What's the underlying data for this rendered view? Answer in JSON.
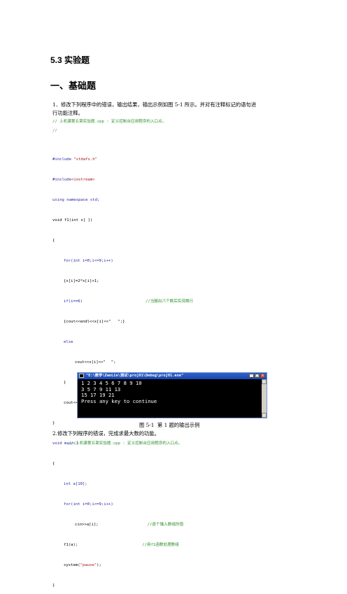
{
  "section_title": "5.3 实验题",
  "part_title": "一、基础题",
  "q1": {
    "line1": "1．修改下列程序中的错误，输出结果，输出示例如图 5-1 所示。并对有注释标记的语句进",
    "line2": "行功能注释。"
  },
  "code": {
    "c1": "// 上机课第五章实验题.cpp : 定义控制台应用程序的入口点。",
    "c2": "//",
    "lines": {
      "l1a": "#include ",
      "l1b": "\"stdafx.h\"",
      "l2a": "#include",
      "l2b": "<iostream>",
      "l3": "using namespace std;",
      "l4": "void f1(int x[ ])",
      "l5": "{",
      "l6": "for(int i=0;i<=9;i++)",
      "l7": "{x[i]=2*x[i]+1;",
      "l8a": "if(i==6)",
      "l8b": "//当输出六个数后实现换行",
      "l9a": "{cout<<endl<<x[i]<<\"",
      "l9b": "\";}",
      "l10": "else",
      "l11a": "cout<<x[i]<<\"",
      "l11b": "\";",
      "l12": "}",
      "l13": "cout<<endl;",
      "l14": "}",
      "l15": "void main()",
      "l16": "{",
      "l17": "int a[10];",
      "l18": "for(int i=0;i<=9;i++)",
      "l19a": "cin>>a[i];",
      "l19b": "//逐个输入数组的值",
      "l20a": "f1(a);",
      "l20b": "//用f1函数处理数组",
      "l21a": "system(",
      "l21b": "\"pause\"",
      "l21c": ");",
      "l22": "}"
    }
  },
  "console": {
    "title": "\"E:\\教学\\ZaoLin\\测试\\proj01\\Debug\\proj01.exe\"",
    "line1": "1 2 3 4 5 6 7 8 9 10",
    "line2": "3  5  7  9  11  13",
    "line3": "15  17  19  21",
    "line4": "Press any key to continue",
    "btn_min": "_",
    "btn_max": "□",
    "btn_close": "×"
  },
  "figure_caption": "图 5-1  第 1 题的输出示例",
  "q2": "2.修改下列程序的错误，完成求最大数的功能。",
  "q2_comment": "// 上机课第五章实验题.cpp : 定义控制台应用程序的入口点。",
  "colors": {
    "keyword": "#1f1f9f",
    "comment": "#2b8f2b",
    "string": "#a31515",
    "console_bg": "#000000",
    "titlebar": "#2d63d2"
  }
}
